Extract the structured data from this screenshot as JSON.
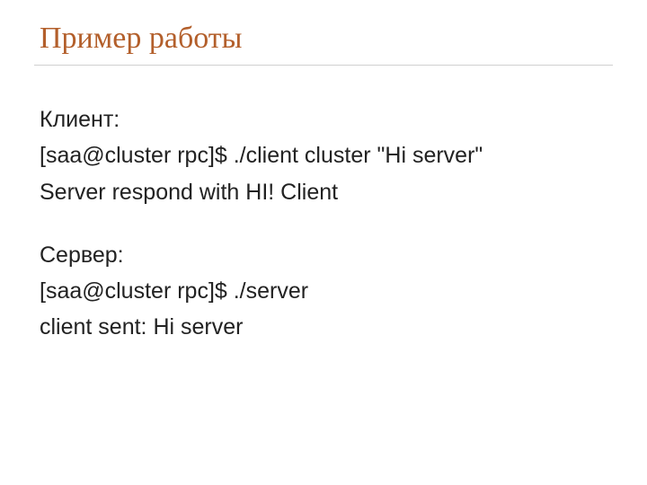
{
  "title": "Пример работы",
  "body": {
    "client_label": "Клиент:",
    "client_cmd": "[saa@cluster rpc]$ ./client cluster \"Hi server\"",
    "client_out": "Server respond with HI! Client",
    "server_label": "Сервер:",
    "server_cmd": "[saa@cluster rpc]$ ./server",
    "server_out": "client sent: Hi server"
  }
}
